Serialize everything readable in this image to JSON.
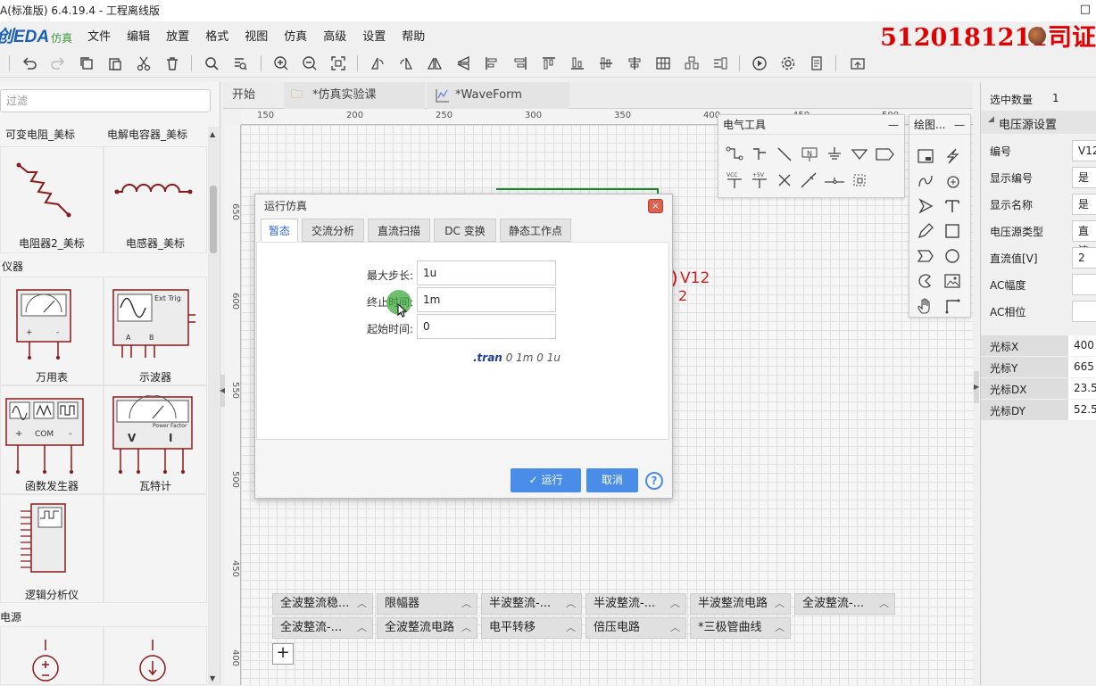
{
  "title": "A(标准版) 6.4.19.4 - 工程离线版",
  "window_buttons": "□",
  "logo": {
    "text": "创EDA",
    "sub": "仿真"
  },
  "menu": [
    "文件",
    "编辑",
    "放置",
    "格式",
    "视图",
    "仿真",
    "高级",
    "设置",
    "帮助"
  ],
  "watermark": "5120181211司证",
  "toolbar_icons": [
    "undo-icon",
    "redo-icon",
    "copy-icon",
    "paste-icon",
    "cut-icon",
    "delete-icon",
    "search-icon",
    "find-list-icon",
    "zoom-in-icon",
    "zoom-out-icon",
    "fit-icon",
    "rotate-left-icon",
    "rotate-right-icon",
    "flip-h-icon",
    "flip-v-icon",
    "align-left-icon",
    "align-center-icon",
    "align-right-icon",
    "align-top-icon",
    "align-bottom-icon",
    "align-middle-icon",
    "distribute-h-icon",
    "distribute-v-icon",
    "grid-icon",
    "group-icon",
    "run-icon",
    "settings-icon",
    "document-icon",
    "export-icon"
  ],
  "left": {
    "filter_placeholder": "过滤",
    "top_labels": [
      "可变电阻_美标",
      "电解电容器_美标"
    ],
    "parts": [
      {
        "name": "电阻器2_美标"
      },
      {
        "name": "电感器_美标"
      }
    ],
    "group_instruments": "仪器",
    "instruments": [
      {
        "name": "万用表"
      },
      {
        "name": "示波器",
        "tag": "Ext Trig",
        "pins": [
          "A",
          "B"
        ]
      },
      {
        "name": "函数发生器",
        "pins": [
          "+",
          "COM",
          "-"
        ]
      },
      {
        "name": "瓦特计",
        "tag": "Power Factor",
        "pins": [
          "V",
          "I"
        ]
      },
      {
        "name": "逻辑分析仪"
      }
    ],
    "group_power": "电源"
  },
  "tabs": [
    {
      "label": "开始"
    },
    {
      "label": "*仿真实验课"
    },
    {
      "label": "*WaveForm"
    }
  ],
  "ruler_h": [
    "150",
    "200",
    "250",
    "300",
    "350",
    "400",
    "450",
    "500"
  ],
  "ruler_v": [
    "650",
    "600",
    "550",
    "500",
    "450",
    "400"
  ],
  "canvas": {
    "component_label": "V12",
    "component_value": "2"
  },
  "elec_tools": {
    "title": "电气工具",
    "close": "—",
    "vcc": "VCC",
    "plus5": "+5V",
    "netlabel": "N"
  },
  "draw_tools": {
    "title": "绘图...",
    "close": "—"
  },
  "right": {
    "selected_label": "选中数量",
    "selected_value": "1",
    "section": "电压源设置",
    "props": [
      {
        "label": "编号",
        "value": "V12"
      },
      {
        "label": "显示编号",
        "value": "是"
      },
      {
        "label": "显示名称",
        "value": "是"
      },
      {
        "label": "电压源类型",
        "value": "直流"
      },
      {
        "label": "直流值[V]",
        "value": "2"
      },
      {
        "label": "AC幅度",
        "value": ""
      },
      {
        "label": "AC相位",
        "value": ""
      }
    ],
    "cursor": [
      {
        "label": "光标X",
        "value": "400"
      },
      {
        "label": "光标Y",
        "value": "665"
      },
      {
        "label": "光标DX",
        "value": "23.5"
      },
      {
        "label": "光标DY",
        "value": "52.5"
      }
    ]
  },
  "bottom_tabs_row1": [
    "全波整流稳...",
    "限幅器",
    "半波整流-...",
    "半波整流-...",
    "半波整流电路",
    "全波整流-..."
  ],
  "bottom_tabs_row2": [
    "全波整流-...",
    "全波整流电路",
    "电平转移",
    "倍压电路",
    "*三极管曲线"
  ],
  "add_tab": "+",
  "dialog": {
    "title": "运行仿真",
    "close": "×",
    "tabs": [
      "暂态",
      "交流分析",
      "直流扫描",
      "DC 变换",
      "静态工作点"
    ],
    "fields": [
      {
        "label": "最大步长:",
        "value": "1u"
      },
      {
        "label": "终止时间:",
        "value": "1m"
      },
      {
        "label": "起始时间:",
        "value": "0"
      }
    ],
    "directive_cmd": ".tran",
    "directive_args": "0 1m 0 1u",
    "run_label": "运行",
    "run_check": "✓",
    "cancel_label": "取消",
    "help": "?"
  },
  "colors": {
    "accent": "#4a8de8",
    "wire": "#1a8a2a",
    "component_red": "#cc2020",
    "watermark": "#e00000"
  }
}
